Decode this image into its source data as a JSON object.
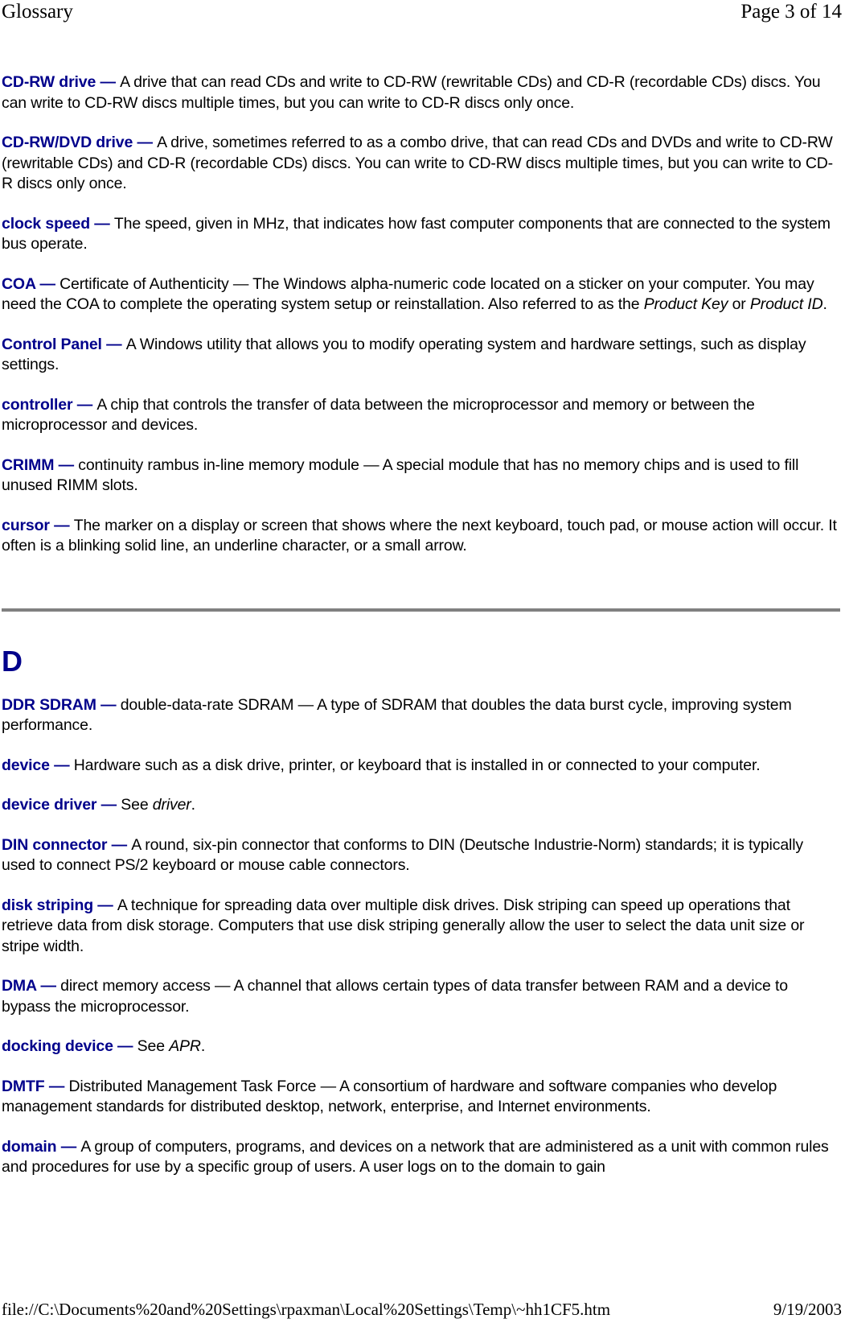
{
  "header": {
    "title": "Glossary",
    "page_indicator": "Page 3 of 14"
  },
  "footer": {
    "file_path": "file://C:\\Documents%20and%20Settings\\rpaxman\\Local%20Settings\\Temp\\~hh1CF5.htm",
    "date": "9/19/2003"
  },
  "colors": {
    "term": "#00008b",
    "divider": "#808080",
    "text": "#000000",
    "background": "#ffffff"
  },
  "section_letter": "D",
  "entries_c": [
    {
      "term": "CD-RW drive",
      "dash": " — ",
      "definition": "A drive that can read CDs and write to CD-RW (rewritable CDs) and CD-R (recordable CDs) discs. You can write to CD-RW discs multiple times, but you can write to CD-R discs only once."
    },
    {
      "term": "CD-RW/DVD drive",
      "dash": " — ",
      "definition": "A drive, sometimes referred to as a combo drive, that can read CDs and DVDs and write to CD-RW (rewritable CDs) and CD-R (recordable CDs) discs. You can write to CD-RW discs multiple times, but you can write to CD-R discs only once."
    },
    {
      "term": "clock speed",
      "dash": " — ",
      "definition": "The speed, given in MHz, that indicates how fast computer components that are connected to the system bus operate."
    },
    {
      "term": "COA",
      "dash": " — ",
      "definition_part1": "Certificate of Authenticity — The Windows alpha-numeric code located on a sticker on your computer. You may need the COA to complete the operating system setup or reinstallation. Also referred to as the ",
      "italic1": "Product Key",
      "definition_part2": " or ",
      "italic2": "Product ID",
      "definition_part3": "."
    },
    {
      "term": "Control Panel",
      "dash": " —  ",
      "definition": "A Windows utility that allows you to modify operating system and hardware settings, such as display settings."
    },
    {
      "term": "controller",
      "dash": " — ",
      "definition": "A chip that controls the transfer of data between the microprocessor and memory or between the microprocessor and devices."
    },
    {
      "term": "CRIMM",
      "dash": " — ",
      "definition": "continuity rambus in-line memory module — A special module that has no memory chips and is used to fill unused RIMM slots."
    },
    {
      "term": "cursor",
      "dash": " — ",
      "definition": "The marker on a display or screen that shows where the next keyboard, touch pad, or mouse action will occur. It often is a blinking solid line, an underline character, or a small arrow."
    }
  ],
  "entries_d": [
    {
      "term": "DDR SDRAM",
      "dash": " — ",
      "definition": "double-data-rate SDRAM — A type of SDRAM that doubles the data burst cycle, improving system performance."
    },
    {
      "term": "device",
      "dash": " — ",
      "definition": "Hardware such as a disk drive, printer, or keyboard that is installed in or connected to your computer."
    },
    {
      "term": "device driver",
      "dash": " — ",
      "definition_part1": "See ",
      "italic1": "driver",
      "definition_part3": "."
    },
    {
      "term": "DIN connector",
      "dash": " — ",
      "definition": "A round, six-pin connector that conforms to DIN (Deutsche Industrie-Norm) standards; it is typically used to connect PS/2 keyboard or mouse cable connectors."
    },
    {
      "term": "disk striping",
      "dash": " — ",
      "definition": "A technique for spreading data over multiple disk drives. Disk striping can speed up operations that retrieve data from disk storage. Computers that use disk striping generally allow the user to select the data unit size or stripe width."
    },
    {
      "term": "DMA",
      "dash": " — ",
      "definition": "direct memory access — A channel that allows certain types of data transfer between RAM and a device to bypass the microprocessor."
    },
    {
      "term": "docking device",
      "dash": " — ",
      "definition_part1": "See ",
      "italic1": "APR",
      "definition_part3": "."
    },
    {
      "term": "DMTF",
      "dash": " — ",
      "definition": "Distributed Management Task Force — A consortium of hardware and software companies who develop management standards for distributed desktop, network, enterprise, and Internet environments."
    },
    {
      "term": "domain",
      "dash": " — ",
      "definition": "A group of computers, programs, and devices on a network that are administered as a unit with common rules and procedures for use by a specific group of users. A user logs on to the domain to gain"
    }
  ]
}
